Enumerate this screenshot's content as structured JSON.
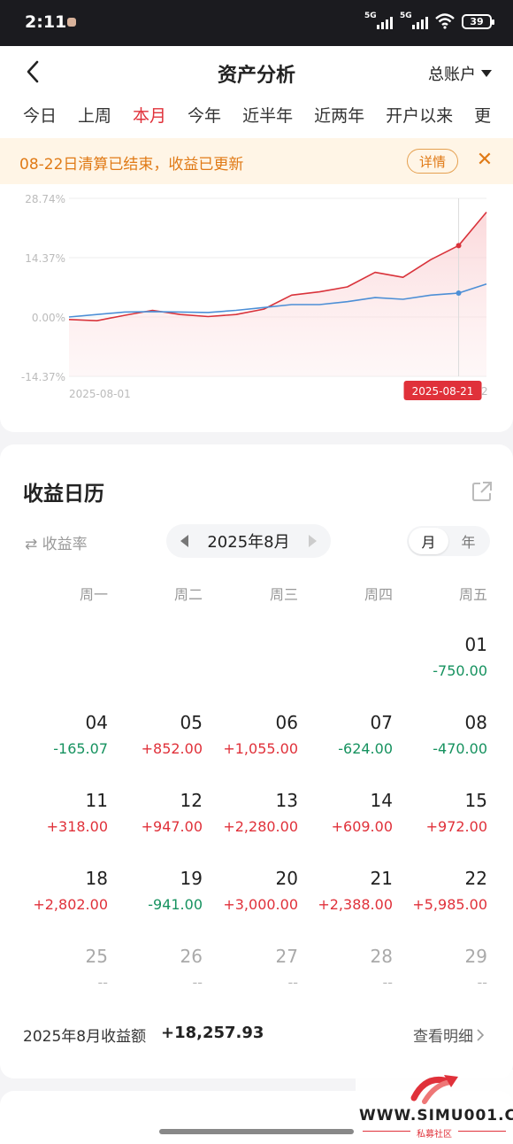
{
  "status_bar": {
    "time": "2:11",
    "network1": "5G",
    "network2": "5G",
    "battery": "39"
  },
  "header": {
    "title": "资产分析",
    "account": "总账户"
  },
  "tabs": [
    {
      "label": "今日",
      "active": false
    },
    {
      "label": "上周",
      "active": false
    },
    {
      "label": "本月",
      "active": true
    },
    {
      "label": "今年",
      "active": false
    },
    {
      "label": "近半年",
      "active": false
    },
    {
      "label": "近两年",
      "active": false
    },
    {
      "label": "开户以来",
      "active": false
    },
    {
      "label": "更",
      "active": false
    }
  ],
  "notice": {
    "text": "08-22日清算已结束，收益已更新",
    "detail_label": "详情"
  },
  "chart_data": {
    "type": "line",
    "y_ticks": [
      "28.74%",
      "14.37%",
      "0.00%",
      "-14.37%"
    ],
    "ylim": [
      -14.37,
      28.74
    ],
    "x_start_label": "2025-08-01",
    "cursor_label": "2025-08-21",
    "x_end_label_partial": "2",
    "x": [
      "08-01",
      "08-04",
      "08-05",
      "08-06",
      "08-07",
      "08-08",
      "08-11",
      "08-12",
      "08-13",
      "08-14",
      "08-15",
      "08-18",
      "08-19",
      "08-20",
      "08-21",
      "08-22"
    ],
    "series": [
      {
        "color": "#d9333b",
        "values": [
          -0.6,
          -0.9,
          0.4,
          1.6,
          0.6,
          0.1,
          0.6,
          1.9,
          5.3,
          6.1,
          7.3,
          10.8,
          9.6,
          13.9,
          17.3,
          25.4
        ]
      },
      {
        "color": "#4d8fd6",
        "values": [
          0.0,
          0.6,
          1.2,
          1.3,
          1.2,
          1.1,
          1.6,
          2.3,
          3.0,
          3.0,
          3.7,
          4.7,
          4.3,
          5.3,
          5.8,
          8.0
        ]
      }
    ],
    "cursor_index": 14,
    "grid": true,
    "area_fill": true
  },
  "calendar": {
    "title": "收益日历",
    "toggle_label": "收益率",
    "month": "2025年8月",
    "seg_month": "月",
    "seg_year": "年",
    "weekdays": [
      "周一",
      "周二",
      "周三",
      "周四",
      "周五"
    ],
    "weeks": [
      [
        null,
        null,
        null,
        null,
        {
          "day": "01",
          "value": "-750.00",
          "sign": "neg"
        }
      ],
      [
        {
          "day": "04",
          "value": "-165.07",
          "sign": "neg"
        },
        {
          "day": "05",
          "value": "+852.00",
          "sign": "pos"
        },
        {
          "day": "06",
          "value": "+1,055.00",
          "sign": "pos"
        },
        {
          "day": "07",
          "value": "-624.00",
          "sign": "neg"
        },
        {
          "day": "08",
          "value": "-470.00",
          "sign": "neg"
        }
      ],
      [
        {
          "day": "11",
          "value": "+318.00",
          "sign": "pos"
        },
        {
          "day": "12",
          "value": "+947.00",
          "sign": "pos"
        },
        {
          "day": "13",
          "value": "+2,280.00",
          "sign": "pos"
        },
        {
          "day": "14",
          "value": "+609.00",
          "sign": "pos"
        },
        {
          "day": "15",
          "value": "+972.00",
          "sign": "pos"
        }
      ],
      [
        {
          "day": "18",
          "value": "+2,802.00",
          "sign": "pos"
        },
        {
          "day": "19",
          "value": "-941.00",
          "sign": "neg"
        },
        {
          "day": "20",
          "value": "+3,000.00",
          "sign": "pos"
        },
        {
          "day": "21",
          "value": "+2,388.00",
          "sign": "pos"
        },
        {
          "day": "22",
          "value": "+5,985.00",
          "sign": "pos"
        }
      ],
      [
        {
          "day": "25",
          "value": "--",
          "sign": "future"
        },
        {
          "day": "26",
          "value": "--",
          "sign": "future"
        },
        {
          "day": "27",
          "value": "--",
          "sign": "future"
        },
        {
          "day": "28",
          "value": "--",
          "sign": "future"
        },
        {
          "day": "29",
          "value": "--",
          "sign": "future"
        }
      ]
    ],
    "footer_label": "2025年8月收益额",
    "footer_value": "+18,257.93",
    "detail_link": "查看明细"
  },
  "watermark": {
    "text": "WWW.SIMU001.CN",
    "sub": "私募社区"
  }
}
